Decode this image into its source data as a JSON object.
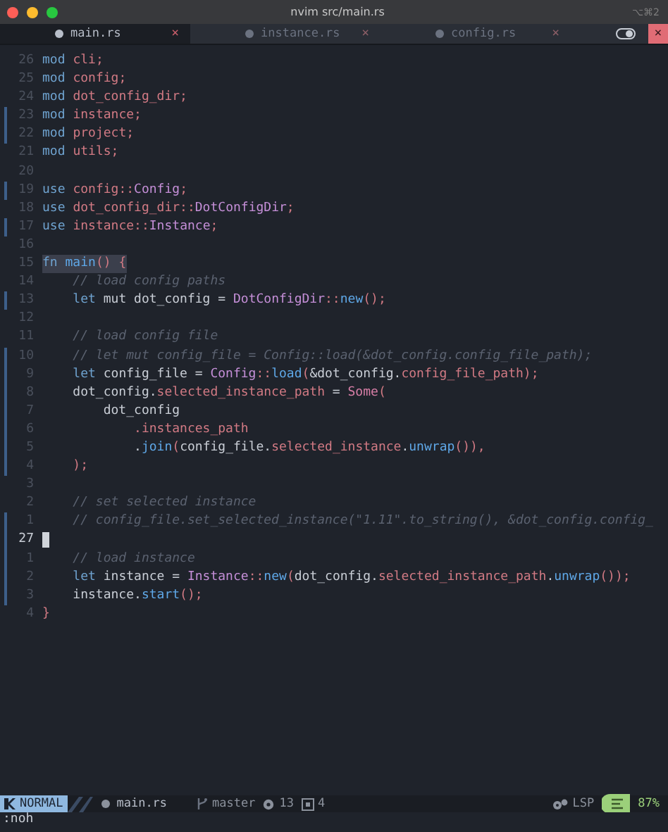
{
  "window": {
    "title": "nvim src/main.rs",
    "shortcut": "⌥⌘2"
  },
  "tabs": [
    {
      "label": "main.rs",
      "selected": true,
      "close": "×"
    },
    {
      "label": "instance.rs",
      "selected": false,
      "close": "×"
    },
    {
      "label": "config.rs",
      "selected": false,
      "close": "×"
    }
  ],
  "tabbar_close": "×",
  "lines": [
    {
      "number": "26",
      "git_mark": false,
      "current": false,
      "match_highlight": false,
      "segments": [
        {
          "kind": "keyword",
          "text": "mod "
        },
        {
          "kind": "module",
          "text": "cli"
        },
        {
          "kind": "punct",
          "text": ";"
        }
      ]
    },
    {
      "number": "25",
      "git_mark": false,
      "current": false,
      "match_highlight": false,
      "segments": [
        {
          "kind": "keyword",
          "text": "mod "
        },
        {
          "kind": "module",
          "text": "config"
        },
        {
          "kind": "punct",
          "text": ";"
        }
      ]
    },
    {
      "number": "24",
      "git_mark": false,
      "current": false,
      "match_highlight": false,
      "segments": [
        {
          "kind": "keyword",
          "text": "mod "
        },
        {
          "kind": "module",
          "text": "dot_config_dir"
        },
        {
          "kind": "punct",
          "text": ";"
        }
      ]
    },
    {
      "number": "23",
      "git_mark": true,
      "current": false,
      "match_highlight": false,
      "segments": [
        {
          "kind": "keyword",
          "text": "mod "
        },
        {
          "kind": "module",
          "text": "instance"
        },
        {
          "kind": "punct",
          "text": ";"
        }
      ]
    },
    {
      "number": "22",
      "git_mark": true,
      "current": false,
      "match_highlight": false,
      "segments": [
        {
          "kind": "keyword",
          "text": "mod "
        },
        {
          "kind": "module",
          "text": "project"
        },
        {
          "kind": "punct",
          "text": ";"
        }
      ]
    },
    {
      "number": "21",
      "git_mark": false,
      "current": false,
      "match_highlight": false,
      "segments": [
        {
          "kind": "keyword",
          "text": "mod "
        },
        {
          "kind": "module",
          "text": "utils"
        },
        {
          "kind": "punct",
          "text": ";"
        }
      ]
    },
    {
      "number": "20",
      "git_mark": false,
      "current": false,
      "match_highlight": false
    },
    {
      "number": "19",
      "git_mark": true,
      "current": false,
      "match_highlight": false,
      "segments": [
        {
          "kind": "keyword",
          "text": "use "
        },
        {
          "kind": "module",
          "text": "config"
        },
        {
          "kind": "punct",
          "text": "::"
        },
        {
          "kind": "type",
          "text": "Config"
        },
        {
          "kind": "punct",
          "text": ";"
        }
      ]
    },
    {
      "number": "18",
      "git_mark": false,
      "current": false,
      "match_highlight": false,
      "segments": [
        {
          "kind": "keyword",
          "text": "use "
        },
        {
          "kind": "module",
          "text": "dot_config_dir"
        },
        {
          "kind": "punct",
          "text": "::"
        },
        {
          "kind": "type",
          "text": "DotConfigDir"
        },
        {
          "kind": "punct",
          "text": ";"
        }
      ]
    },
    {
      "number": "17",
      "git_mark": true,
      "current": false,
      "match_highlight": false,
      "segments": [
        {
          "kind": "keyword",
          "text": "use "
        },
        {
          "kind": "module",
          "text": "instance"
        },
        {
          "kind": "punct",
          "text": "::"
        },
        {
          "kind": "type",
          "text": "Instance"
        },
        {
          "kind": "punct",
          "text": ";"
        }
      ]
    },
    {
      "number": "16",
      "git_mark": false,
      "current": false,
      "match_highlight": false
    },
    {
      "number": "15",
      "git_mark": false,
      "current": false,
      "match_highlight": true,
      "segments": [
        {
          "kind": "keyword",
          "text": "fn "
        },
        {
          "kind": "function",
          "text": "main"
        },
        {
          "kind": "punct",
          "text": "() {"
        }
      ]
    },
    {
      "number": "14",
      "git_mark": false,
      "current": false,
      "match_highlight": false,
      "segments": [
        {
          "kind": "comment",
          "text": "    // load config paths"
        }
      ]
    },
    {
      "number": "13",
      "git_mark": true,
      "current": false,
      "match_highlight": false,
      "segments": [
        {
          "kind": "keyword",
          "text": "    let "
        },
        {
          "kind": "plain",
          "text": "mut dot_config = "
        },
        {
          "kind": "type",
          "text": "DotConfigDir"
        },
        {
          "kind": "punct",
          "text": "::"
        },
        {
          "kind": "function",
          "text": "new"
        },
        {
          "kind": "punct",
          "text": "();"
        }
      ]
    },
    {
      "number": "12",
      "git_mark": false,
      "current": false,
      "match_highlight": false
    },
    {
      "number": "11",
      "git_mark": false,
      "current": false,
      "match_highlight": false,
      "segments": [
        {
          "kind": "comment",
          "text": "    // load config file"
        }
      ]
    },
    {
      "number": "10",
      "git_mark": true,
      "current": false,
      "match_highlight": false,
      "segments": [
        {
          "kind": "comment",
          "text": "    // let mut config_file = Config::load(&dot_config.config_file_path);"
        }
      ]
    },
    {
      "number": "9",
      "git_mark": true,
      "current": false,
      "match_highlight": false,
      "segments": [
        {
          "kind": "keyword",
          "text": "    let "
        },
        {
          "kind": "plain",
          "text": "config_file = "
        },
        {
          "kind": "type",
          "text": "Config"
        },
        {
          "kind": "punct",
          "text": "::"
        },
        {
          "kind": "function",
          "text": "load"
        },
        {
          "kind": "punct",
          "text": "("
        },
        {
          "kind": "plain",
          "text": "&dot_config."
        },
        {
          "kind": "field",
          "text": "config_file_path"
        },
        {
          "kind": "punct",
          "text": ");"
        }
      ]
    },
    {
      "number": "8",
      "git_mark": true,
      "current": false,
      "match_highlight": false,
      "segments": [
        {
          "kind": "plain",
          "text": "    dot_config."
        },
        {
          "kind": "field",
          "text": "selected_instance_path"
        },
        {
          "kind": "plain",
          "text": " = "
        },
        {
          "kind": "variant",
          "text": "Some"
        },
        {
          "kind": "punct",
          "text": "("
        }
      ]
    },
    {
      "number": "7",
      "git_mark": true,
      "current": false,
      "match_highlight": false,
      "segments": [
        {
          "kind": "plain",
          "text": "        dot_config"
        }
      ]
    },
    {
      "number": "6",
      "git_mark": true,
      "current": false,
      "match_highlight": false,
      "segments": [
        {
          "kind": "field",
          "text": "            .instances_path"
        }
      ]
    },
    {
      "number": "5",
      "git_mark": true,
      "current": false,
      "match_highlight": false,
      "segments": [
        {
          "kind": "plain",
          "text": "            ."
        },
        {
          "kind": "function",
          "text": "join"
        },
        {
          "kind": "punct",
          "text": "("
        },
        {
          "kind": "plain",
          "text": "config_file."
        },
        {
          "kind": "field",
          "text": "selected_instance"
        },
        {
          "kind": "plain",
          "text": "."
        },
        {
          "kind": "function",
          "text": "unwrap"
        },
        {
          "kind": "punct",
          "text": "()),"
        }
      ]
    },
    {
      "number": "4",
      "git_mark": true,
      "current": false,
      "match_highlight": false,
      "segments": [
        {
          "kind": "punct",
          "text": "    );"
        }
      ]
    },
    {
      "number": "3",
      "git_mark": false,
      "current": false,
      "match_highlight": false
    },
    {
      "number": "2",
      "git_mark": false,
      "current": false,
      "match_highlight": false,
      "segments": [
        {
          "kind": "comment",
          "text": "    // set selected instance"
        }
      ]
    },
    {
      "number": "1",
      "git_mark": true,
      "current": false,
      "match_highlight": false,
      "segments": [
        {
          "kind": "comment",
          "text": "    // config_file.set_selected_instance(\"1.11\".to_string(), &dot_config.config_"
        }
      ]
    },
    {
      "number": "27",
      "git_mark": true,
      "current": true,
      "match_highlight": false
    },
    {
      "number": "1",
      "git_mark": true,
      "current": false,
      "match_highlight": false,
      "segments": [
        {
          "kind": "comment",
          "text": "    // load instance"
        }
      ]
    },
    {
      "number": "2",
      "git_mark": true,
      "current": false,
      "match_highlight": false,
      "segments": [
        {
          "kind": "keyword",
          "text": "    let "
        },
        {
          "kind": "plain",
          "text": "instance = "
        },
        {
          "kind": "type",
          "text": "Instance"
        },
        {
          "kind": "punct",
          "text": "::"
        },
        {
          "kind": "function",
          "text": "new"
        },
        {
          "kind": "punct",
          "text": "("
        },
        {
          "kind": "plain",
          "text": "dot_config."
        },
        {
          "kind": "field",
          "text": "selected_instance_path"
        },
        {
          "kind": "plain",
          "text": "."
        },
        {
          "kind": "function",
          "text": "unwrap"
        },
        {
          "kind": "punct",
          "text": "());"
        }
      ]
    },
    {
      "number": "3",
      "git_mark": true,
      "current": false,
      "match_highlight": false,
      "segments": [
        {
          "kind": "plain",
          "text": "    instance."
        },
        {
          "kind": "function",
          "text": "start"
        },
        {
          "kind": "punct",
          "text": "();"
        }
      ]
    },
    {
      "number": "4",
      "git_mark": false,
      "current": false,
      "match_highlight": false,
      "segments": [
        {
          "kind": "punct",
          "text": "}"
        }
      ]
    }
  ],
  "status_bar": {
    "mode": "NORMAL",
    "file": "main.rs",
    "branch": "master",
    "warnings": "13",
    "infos": "4",
    "lsp": "LSP",
    "progress": "87%"
  },
  "command_line": ":noh"
}
